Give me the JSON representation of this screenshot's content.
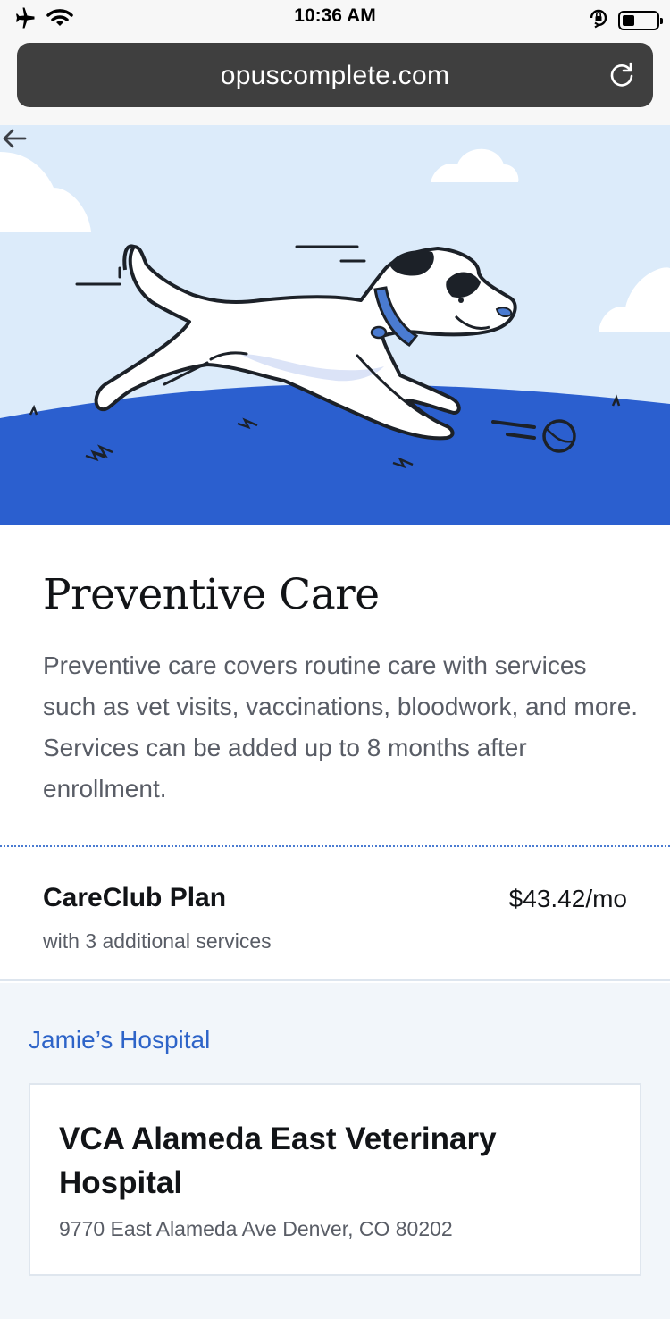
{
  "status_bar": {
    "time": "10:36 AM",
    "battery_level": 0.35,
    "icons": [
      "airplane-icon",
      "wifi-icon",
      "orientation-lock-icon",
      "battery-icon"
    ]
  },
  "browser": {
    "url": "opuscomplete.com",
    "reload_icon": "reload-icon"
  },
  "hero": {
    "back_icon": "back-arrow-icon",
    "illustration": "running-dog-illustration",
    "colors": {
      "sky": "#dcebfa",
      "grass": "#2b5fcf",
      "collar": "#4a7bd1"
    }
  },
  "content": {
    "title": "Preventive Care",
    "description": "Preventive care covers routine care with services such as vet visits, vaccinations, bloodwork, and more. Services can be added up to 8 months after enrollment."
  },
  "plan": {
    "name": "CareClub Plan",
    "price": "$43.42/mo",
    "subtitle": "with 3 additional services"
  },
  "hospital": {
    "link_label": "Jamie’s Hospital",
    "name": "VCA Alameda East Veterinary Hospital",
    "address": "9770 East Alameda Ave Denver, CO 80202"
  },
  "colors": {
    "accent": "#2e64c8",
    "text": "#121417",
    "muted": "#595d66"
  }
}
